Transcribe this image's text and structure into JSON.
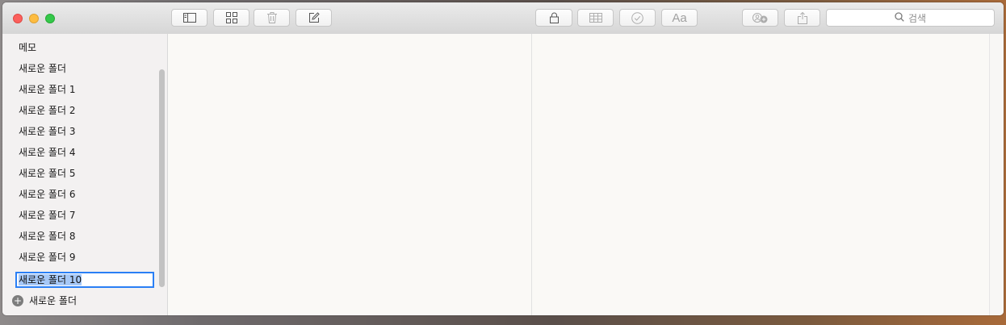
{
  "window": {
    "buttons": [
      "close",
      "minimize",
      "maximize"
    ]
  },
  "toolbar": {
    "icons": [
      "sidebar-toggle-icon",
      "grid-view-icon",
      "trash-icon",
      "compose-icon",
      "lock-icon",
      "table-icon",
      "checklist-icon",
      "format-icon",
      "add-people-icon",
      "share-icon"
    ],
    "format_label": "Aa",
    "search_placeholder": "검색"
  },
  "sidebar": {
    "folders": [
      "메모",
      "새로운 폴더",
      "새로운 폴더 1",
      "새로운 폴더 2",
      "새로운 폴더 3",
      "새로운 폴더 4",
      "새로운 폴더 5",
      "새로운 폴더 6",
      "새로운 폴더 7",
      "새로운 폴더 8",
      "새로운 폴더 9"
    ],
    "editing_folder": "새로운 폴더 10",
    "new_folder_label": "새로운 폴더"
  },
  "colors": {
    "accent": "#2a7ff5",
    "selection": "#a6c8f7"
  }
}
